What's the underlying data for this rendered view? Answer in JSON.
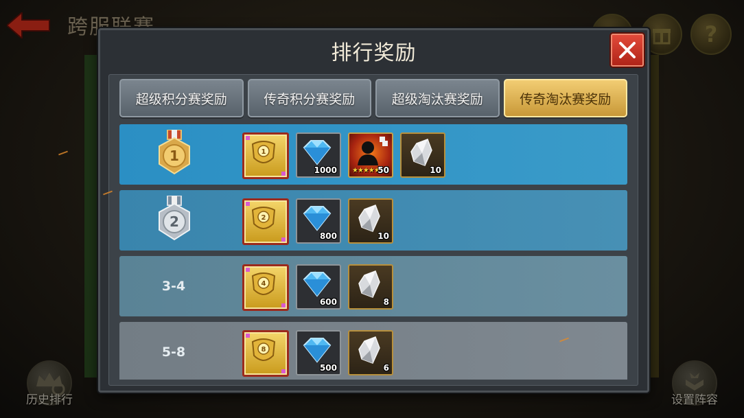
{
  "background": {
    "title": "跨服联赛",
    "top_buttons": [
      "gift-icon",
      "help-icon"
    ],
    "history_button_label": "历史排行",
    "lineup_button_label": "设置阵容",
    "help_glyph": "?"
  },
  "modal": {
    "title": "排行奖励",
    "close_icon": "close-icon",
    "tabs": [
      {
        "label": "超级积分赛奖励",
        "active": false
      },
      {
        "label": "传奇积分赛奖励",
        "active": false
      },
      {
        "label": "超级淘汰赛奖励",
        "active": false
      },
      {
        "label": "传奇淘汰赛奖励",
        "active": true
      }
    ],
    "rows": [
      {
        "rank_label": "1",
        "rank_type": "gold-medal",
        "items": [
          {
            "type": "badge",
            "badge_number": "1",
            "qty": ""
          },
          {
            "type": "diamond",
            "qty": "1000"
          },
          {
            "type": "hero-fragment",
            "qty": "50",
            "stars": "★★★★★"
          },
          {
            "type": "crystal",
            "qty": "10"
          }
        ]
      },
      {
        "rank_label": "2",
        "rank_type": "silver-medal",
        "items": [
          {
            "type": "badge",
            "badge_number": "2",
            "qty": ""
          },
          {
            "type": "diamond",
            "qty": "800"
          },
          {
            "type": "crystal",
            "qty": "10"
          }
        ]
      },
      {
        "rank_label": "3-4",
        "rank_type": "text",
        "items": [
          {
            "type": "badge",
            "badge_number": "4",
            "qty": ""
          },
          {
            "type": "diamond",
            "qty": "600"
          },
          {
            "type": "crystal",
            "qty": "8"
          }
        ]
      },
      {
        "rank_label": "5-8",
        "rank_type": "text",
        "items": [
          {
            "type": "badge",
            "badge_number": "8",
            "qty": ""
          },
          {
            "type": "diamond",
            "qty": "500"
          },
          {
            "type": "crystal",
            "qty": "6"
          }
        ]
      }
    ]
  },
  "colors": {
    "active_tab": "#e8be5a",
    "row1": "#2f8fbf",
    "row2": "#3e87aa",
    "row3": "#5c8597",
    "row4": "#778189",
    "close_button": "#d23a2a"
  }
}
